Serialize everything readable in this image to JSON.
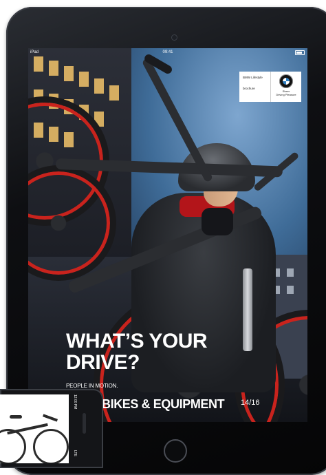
{
  "statusbar": {
    "device": "iPad",
    "time": "09:41"
  },
  "logo_card": {
    "left_title": "BMW Lifestyle",
    "left_sub": "brochure",
    "right_line1": "Sheer",
    "right_line2": "Driving Pleasure",
    "brand_icon": "bmw-roundel-icon"
  },
  "cover": {
    "headline_line1": "WHAT’S YOUR",
    "headline_line2": "DRIVE?",
    "tagline": "PEOPLE IN MOTION.",
    "subhead": "BIKES & EQUIPMENT",
    "issue": "14/16"
  },
  "phone": {
    "status_time": "12:00 PM",
    "status_carrier": "LTE"
  },
  "colors": {
    "accent_red": "#c9231d",
    "headline_text": "#ffffff",
    "device_body": "#0e0f12"
  }
}
